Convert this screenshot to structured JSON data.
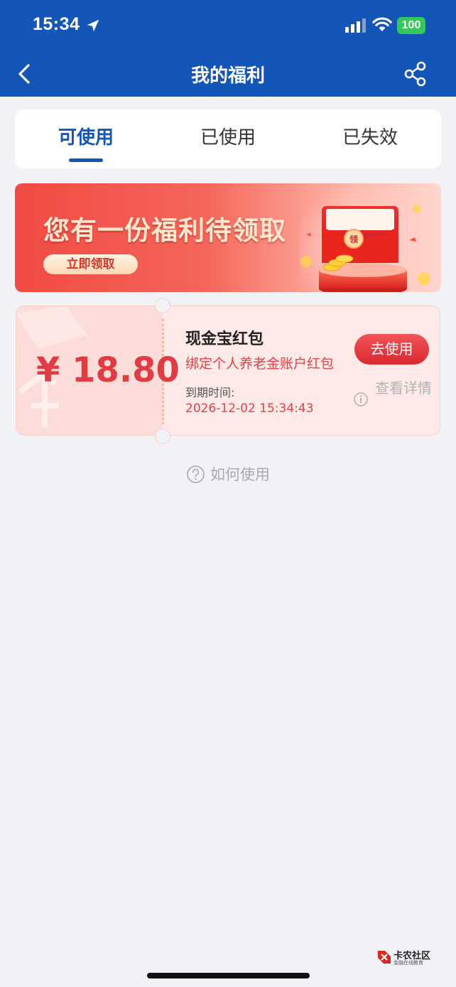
{
  "status_bar": {
    "time": "15:34",
    "battery": "100"
  },
  "header": {
    "title": "我的福利"
  },
  "tabs": [
    {
      "label": "可使用",
      "active": true
    },
    {
      "label": "已使用",
      "active": false
    },
    {
      "label": "已失效",
      "active": false
    }
  ],
  "banner": {
    "title": "您有一份福利待领取",
    "button_label": "立即领取",
    "art_badge": "领"
  },
  "coupon": {
    "amount": "¥ 18.80",
    "title": "现金宝红包",
    "description": "绑定个人养老金账户红包",
    "expiry_label": "到期时间:",
    "expiry_date": "2026-12-02 15:34:43",
    "use_button": "去使用",
    "detail_link": "查看详情"
  },
  "howto": {
    "label": "如何使用"
  },
  "site_logo": {
    "name": "卡农社区",
    "sub": "金融在线教育"
  },
  "colors": {
    "header_bg": "#1456b8",
    "accent_blue": "#1456b8",
    "coupon_red": "#e03c43",
    "page_bg": "#f1f2f6"
  }
}
